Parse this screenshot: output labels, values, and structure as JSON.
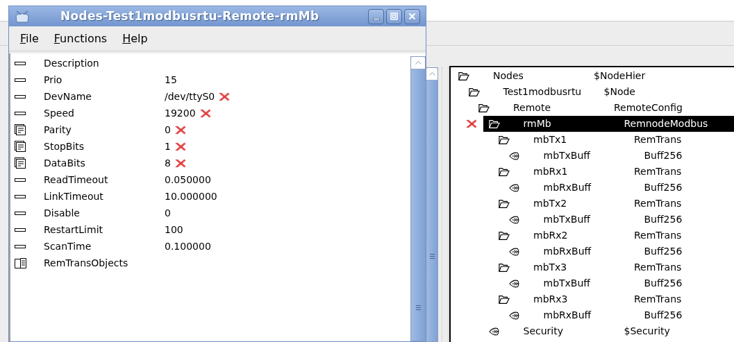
{
  "window": {
    "title": "Nodes-Test1modbusrtu-Remote-rmMb"
  },
  "menu": [
    "File",
    "Functions",
    "Help"
  ],
  "attributes": [
    {
      "kind": "attribute",
      "name": "Description",
      "flagged": false
    },
    {
      "kind": "attribute",
      "name": "Prio",
      "value": "15",
      "flagged": false
    },
    {
      "kind": "attribute",
      "name": "DevName",
      "value": "/dev/ttyS0",
      "flagged": true
    },
    {
      "kind": "attribute",
      "name": "Speed",
      "value": "19200",
      "flagged": true
    },
    {
      "kind": "enum",
      "name": "Parity",
      "value": "0",
      "flagged": true
    },
    {
      "kind": "enum",
      "name": "StopBits",
      "value": "1",
      "flagged": true
    },
    {
      "kind": "enum",
      "name": "DataBits",
      "value": "8",
      "flagged": true
    },
    {
      "kind": "attribute",
      "name": "ReadTimeout",
      "value": "0.050000",
      "flagged": false
    },
    {
      "kind": "attribute",
      "name": "LinkTimeout",
      "value": "10.000000",
      "flagged": false
    },
    {
      "kind": "attribute",
      "name": "Disable",
      "value": "0",
      "flagged": false
    },
    {
      "kind": "attribute",
      "name": "RestartLimit",
      "value": "100",
      "flagged": false
    },
    {
      "kind": "attribute",
      "name": "ScanTime",
      "value": "0.100000",
      "flagged": false
    },
    {
      "kind": "object",
      "name": "RemTransObjects",
      "flagged": false
    }
  ],
  "tree": [
    {
      "kind": "folder",
      "name": "Nodes",
      "class": "$NodeHier",
      "selected": false,
      "flagged": false,
      "children": [
        {
          "kind": "folder",
          "name": "Test1modbusrtu",
          "class": "$Node",
          "selected": false,
          "flagged": false,
          "children": [
            {
              "kind": "folder",
              "name": "Remote",
              "class": "RemoteConfig",
              "selected": false,
              "flagged": false,
              "children": [
                {
                  "kind": "folder",
                  "name": "rmMb",
                  "class": "RemnodeModbus",
                  "selected": true,
                  "flagged": true,
                  "children": [
                    {
                      "kind": "folder",
                      "name": "mbTx1",
                      "class": "RemTrans",
                      "selected": false,
                      "flagged": false,
                      "children": [
                        {
                          "kind": "object",
                          "name": "mbTxBuff",
                          "class": "Buff256",
                          "selected": false,
                          "flagged": false
                        }
                      ]
                    },
                    {
                      "kind": "folder",
                      "name": "mbRx1",
                      "class": "RemTrans",
                      "selected": false,
                      "flagged": false,
                      "children": [
                        {
                          "kind": "object",
                          "name": "mbRxBuff",
                          "class": "Buff256",
                          "selected": false,
                          "flagged": false
                        }
                      ]
                    },
                    {
                      "kind": "folder",
                      "name": "mbTx2",
                      "class": "RemTrans",
                      "selected": false,
                      "flagged": false,
                      "children": [
                        {
                          "kind": "object",
                          "name": "mbTxBuff",
                          "class": "Buff256",
                          "selected": false,
                          "flagged": false
                        }
                      ]
                    },
                    {
                      "kind": "folder",
                      "name": "mbRx2",
                      "class": "RemTrans",
                      "selected": false,
                      "flagged": false,
                      "children": [
                        {
                          "kind": "object",
                          "name": "mbRxBuff",
                          "class": "Buff256",
                          "selected": false,
                          "flagged": false
                        }
                      ]
                    },
                    {
                      "kind": "folder",
                      "name": "mbTx3",
                      "class": "RemTrans",
                      "selected": false,
                      "flagged": false,
                      "children": [
                        {
                          "kind": "object",
                          "name": "mbTxBuff",
                          "class": "Buff256",
                          "selected": false,
                          "flagged": false
                        }
                      ]
                    },
                    {
                      "kind": "folder",
                      "name": "mbRx3",
                      "class": "RemTrans",
                      "selected": false,
                      "flagged": false,
                      "children": [
                        {
                          "kind": "object",
                          "name": "mbRxBuff",
                          "class": "Buff256",
                          "selected": false,
                          "flagged": false
                        }
                      ]
                    }
                  ]
                },
                {
                  "kind": "object",
                  "name": "Security",
                  "class": "$Security",
                  "selected": false,
                  "flagged": false
                }
              ]
            }
          ]
        }
      ]
    }
  ]
}
